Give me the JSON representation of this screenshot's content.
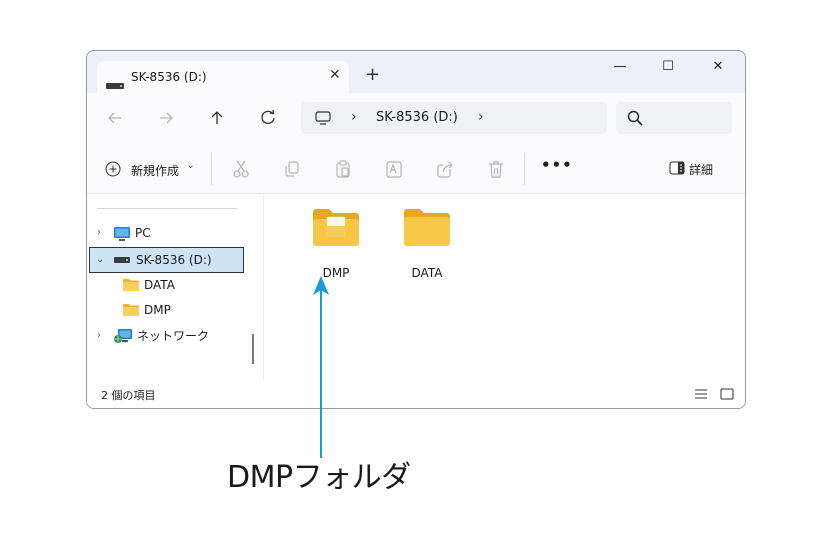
{
  "window": {
    "tab_label": "SK-8536 (D:)",
    "tab_close": "✕",
    "new_tab": "+",
    "minimize": "—",
    "maximize": "☐",
    "close": "✕"
  },
  "address": {
    "separator": "›",
    "crumb": "SK-8536 (D:)"
  },
  "toolbar": {
    "new_label": "新規作成",
    "new_caret": "⌄",
    "more": "•••",
    "details_label": "詳細"
  },
  "sidebar": {
    "items": [
      {
        "label": "PC",
        "chevron": "›",
        "icon": "monitor-icon"
      },
      {
        "label": "SK-8536 (D:)",
        "chevron": "⌄",
        "icon": "drive-icon",
        "selected": true
      },
      {
        "label": "DATA",
        "icon": "folder-icon"
      },
      {
        "label": "DMP",
        "icon": "folder-icon"
      },
      {
        "label": "ネットワーク",
        "chevron": "›",
        "icon": "network-icon"
      }
    ]
  },
  "content": {
    "items": [
      {
        "label": "DMP",
        "icon": "folder-with-file-icon"
      },
      {
        "label": "DATA",
        "icon": "folder-icon"
      }
    ]
  },
  "status": {
    "count": "2 個の項目"
  },
  "annotation": {
    "label": "DMPフォルダ",
    "color": "#1a9ad6"
  },
  "colors": {
    "accent": "#1a9ad6",
    "selection": "#cde4f7",
    "folder": "#f5c242"
  }
}
